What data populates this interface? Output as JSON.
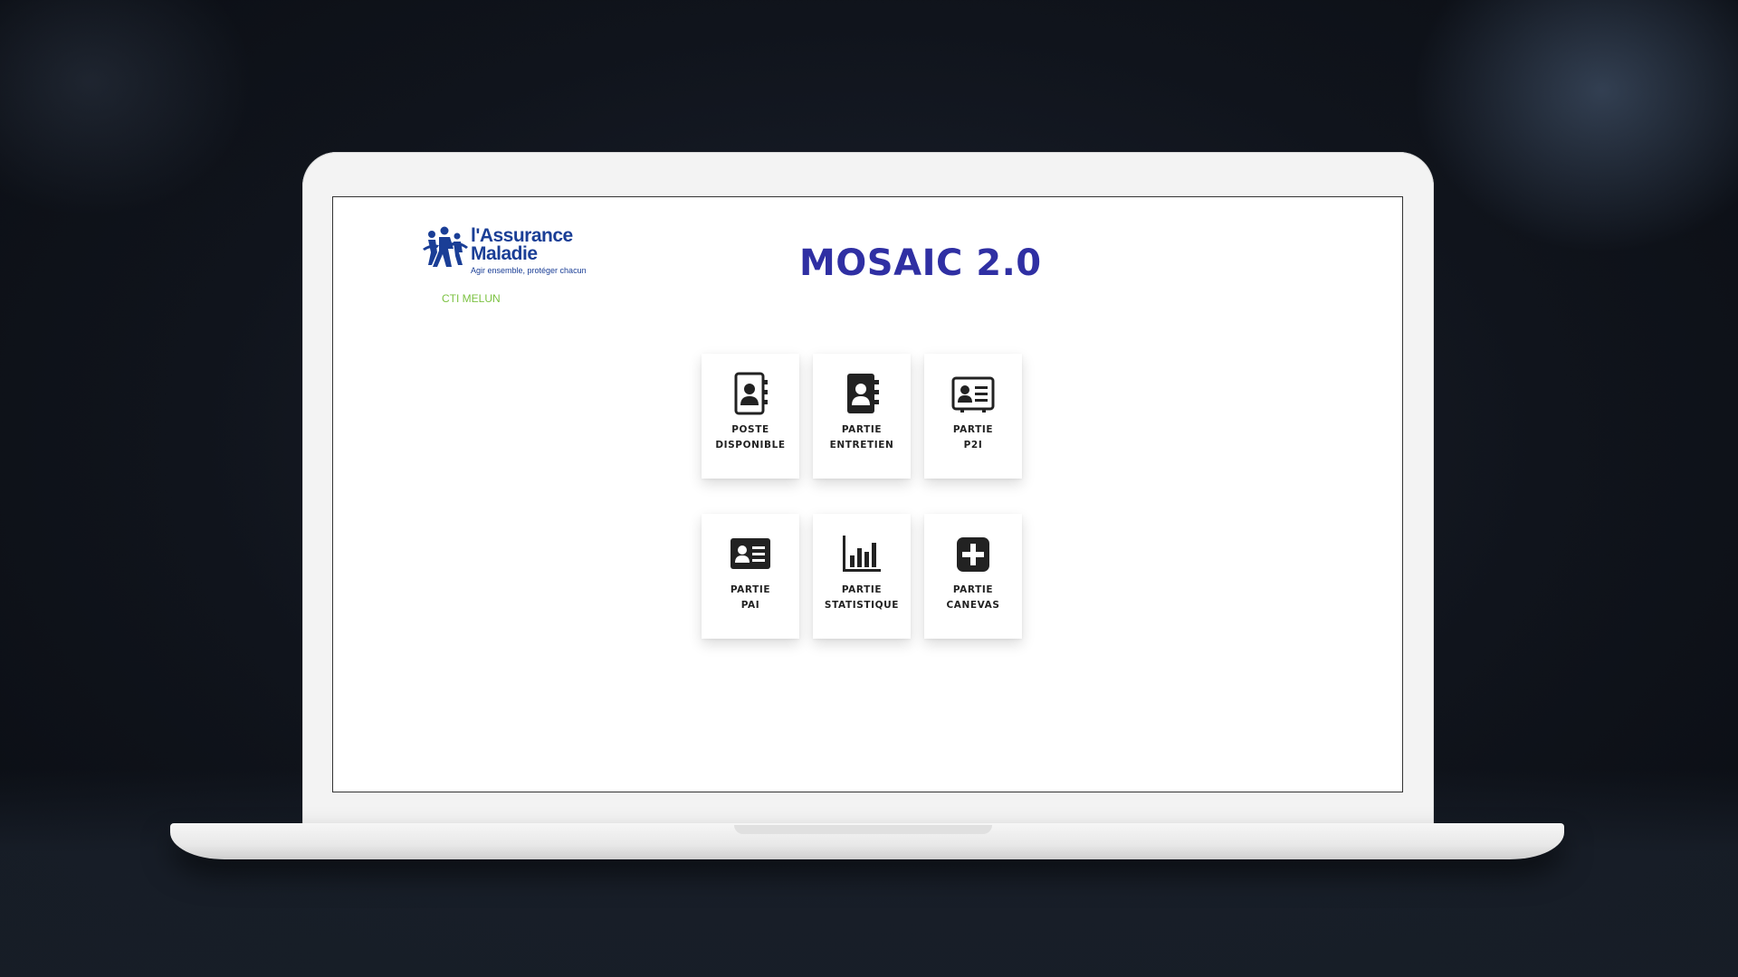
{
  "app": {
    "title": "MOSAIC 2.0"
  },
  "brand": {
    "name_line1": "l'Assurance",
    "name_line2": "Maladie",
    "tagline": "Agir ensemble, protéger chacun",
    "site": "CTI MELUN",
    "colors": {
      "brand_blue": "#1a3e96",
      "site_green": "#7cc242",
      "title_blue": "#2f2fa3"
    }
  },
  "tiles": [
    {
      "line1": "POSTE",
      "line2": "DISPONIBLE",
      "icon": "contact-book-icon"
    },
    {
      "line1": "PARTIE",
      "line2": "ENTRETIEN",
      "icon": "contact-book-filled-icon"
    },
    {
      "line1": "PARTIE",
      "line2": "P2I",
      "icon": "id-card-icon"
    },
    {
      "line1": "PARTIE",
      "line2": "PAI",
      "icon": "id-card-filled-icon"
    },
    {
      "line1": "PARTIE",
      "line2": "STATISTIQUE",
      "icon": "bar-chart-icon"
    },
    {
      "line1": "PARTIE",
      "line2": "CANEVAS",
      "icon": "plus-square-icon"
    }
  ]
}
